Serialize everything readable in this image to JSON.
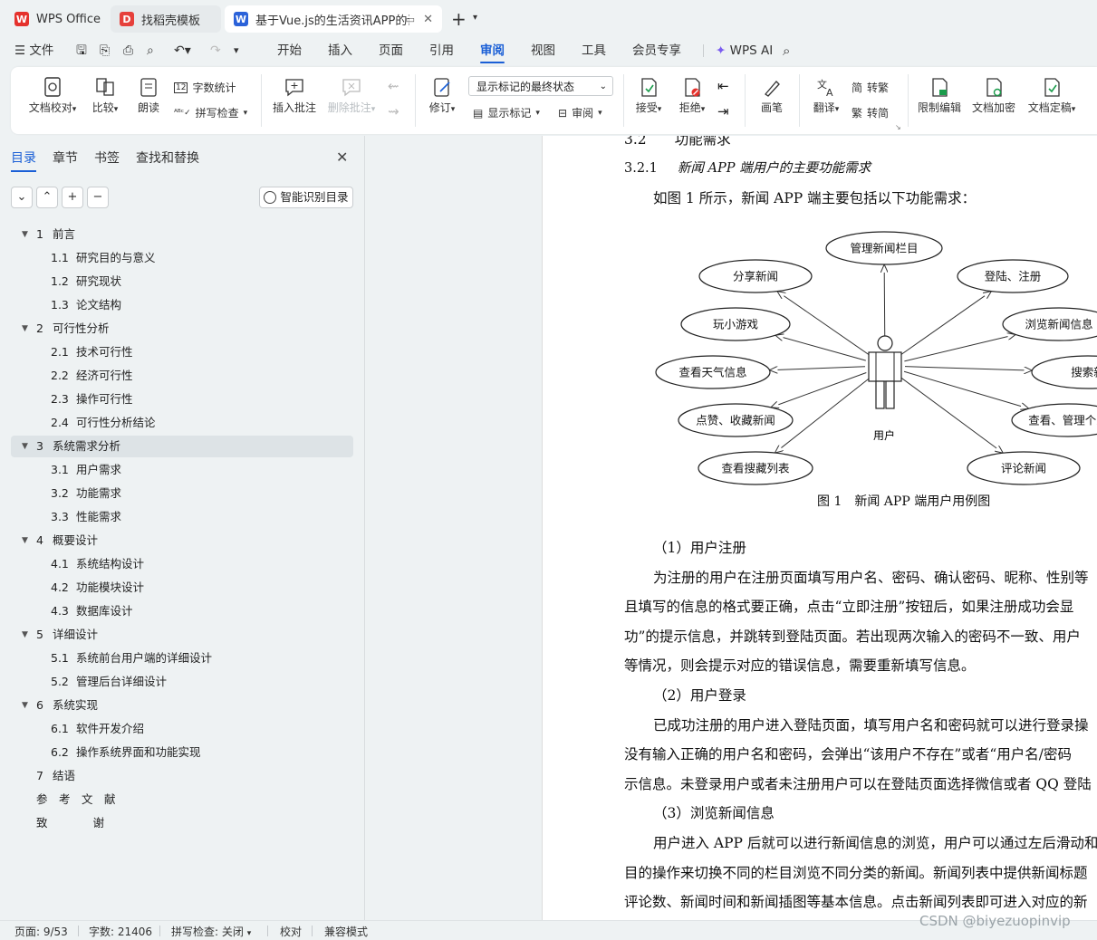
{
  "tabs": [
    {
      "label": "WPS Office",
      "icon": "wps-logo-icon"
    },
    {
      "label": "找稻壳模板",
      "icon": "docer-icon"
    },
    {
      "label": "基于Vue.js的生活资讯APP的设",
      "icon": "word-doc-icon"
    }
  ],
  "menu": {
    "file": "文件",
    "items": [
      "开始",
      "插入",
      "页面",
      "引用",
      "审阅",
      "视图",
      "工具",
      "会员专享"
    ],
    "active": "审阅",
    "wps_ai": "WPS AI"
  },
  "ribbon": {
    "proofread": "文档校对",
    "compare": "比较",
    "read_aloud": "朗读",
    "word_count": "字数统计",
    "spell_check": "拼写检查",
    "insert_comment": "插入批注",
    "delete_comment": "删除批注",
    "revise": "修订",
    "markup_state": "显示标记的最终状态",
    "show_markup": "显示标记",
    "review": "审阅",
    "accept": "接受",
    "reject": "拒绝",
    "pen": "画笔",
    "translate": "翻译",
    "to_traditional": "转繁",
    "to_simplified": "转简",
    "restrict_edit": "限制编辑",
    "encrypt": "文档加密",
    "finalize": "文档定稿"
  },
  "sidebar": {
    "tabs": [
      "目录",
      "章节",
      "书签",
      "查找和替换"
    ],
    "smart_toc": "智能识别目录",
    "toc": [
      {
        "num": "1",
        "title": "前言",
        "level": 1
      },
      {
        "num": "1.1",
        "title": "研究目的与意义",
        "level": 2
      },
      {
        "num": "1.2",
        "title": "研究现状",
        "level": 2
      },
      {
        "num": "1.3",
        "title": "论文结构",
        "level": 2
      },
      {
        "num": "2",
        "title": "可行性分析",
        "level": 1
      },
      {
        "num": "2.1",
        "title": "技术可行性",
        "level": 2
      },
      {
        "num": "2.2",
        "title": "经济可行性",
        "level": 2
      },
      {
        "num": "2.3",
        "title": "操作可行性",
        "level": 2
      },
      {
        "num": "2.4",
        "title": "可行性分析结论",
        "level": 2
      },
      {
        "num": "3",
        "title": "系统需求分析",
        "level": 1
      },
      {
        "num": "3.1",
        "title": "用户需求",
        "level": 2
      },
      {
        "num": "3.2",
        "title": "功能需求",
        "level": 2
      },
      {
        "num": "3.3",
        "title": "性能需求",
        "level": 2
      },
      {
        "num": "4",
        "title": "概要设计",
        "level": 1
      },
      {
        "num": "4.1",
        "title": "系统结构设计",
        "level": 2
      },
      {
        "num": "4.2",
        "title": "功能模块设计",
        "level": 2
      },
      {
        "num": "4.3",
        "title": "数据库设计",
        "level": 2
      },
      {
        "num": "5",
        "title": "详细设计",
        "level": 1
      },
      {
        "num": "5.1",
        "title": "系统前台用户端的详细设计",
        "level": 2
      },
      {
        "num": "5.2",
        "title": "管理后台详细设计",
        "level": 2
      },
      {
        "num": "6",
        "title": "系统实现",
        "level": 1
      },
      {
        "num": "6.1",
        "title": "软件开发介绍",
        "level": 2
      },
      {
        "num": "6.2",
        "title": "操作系统界面和功能实现",
        "level": 2
      },
      {
        "num": "7",
        "title": "结语",
        "level": 1
      },
      {
        "num": "",
        "title": "参　考　文　献",
        "level": 0
      },
      {
        "num": "",
        "title": "致　　　　谢",
        "level": 0
      }
    ]
  },
  "doc": {
    "heading_cut": "3.2　　功能需求",
    "sub_heading_num": "3.2.1",
    "sub_heading": "新闻 APP 端用户的主要功能需求",
    "intro": "如图 1 所示，新闻 APP 端主要包括以下功能需求：",
    "diagram": {
      "actor": "用户",
      "use_cases": [
        "管理新闻栏目",
        "分享新闻",
        "登陆、注册",
        "玩小游戏",
        "浏览新闻信息",
        "查看天气信息",
        "搜索新",
        "点赞、收藏新闻",
        "查看、管理个人",
        "查看搜藏列表",
        "评论新闻"
      ],
      "caption": "图 1　新闻 APP 端用户用例图"
    },
    "paragraphs": [
      "（1）用户注册",
      "为注册的用户在注册页面填写用户名、密码、确认密码、昵称、性别等",
      "且填写的信息的格式要正确，点击“立即注册”按钮后，如果注册成功会显",
      "功”的提示信息，并跳转到登陆页面。若出现两次输入的密码不一致、用户",
      "等情况，则会提示对应的错误信息，需要重新填写信息。",
      "（2）用户登录",
      "已成功注册的用户进入登陆页面，填写用户名和密码就可以进行登录操",
      "没有输入正确的用户名和密码，会弹出“该用户不存在”或者“用户名/密码",
      "示信息。未登录用户或者未注册用户可以在登陆页面选择微信或者 QQ 登陆",
      "（3）浏览新闻信息",
      "用户进入 APP 后就可以进行新闻信息的浏览，用户可以通过左后滑动和",
      "目的操作来切换不同的栏目浏览不同分类的新闻。新闻列表中提供新闻标题",
      "评论数、新闻时间和新闻插图等基本信息。点击新闻列表即可进入对应的新"
    ]
  },
  "status": {
    "page": "页面: 9/53",
    "words": "字数: 21406",
    "spell": "拼写检查: 关闭",
    "proof": "校对",
    "compat": "兼容模式",
    "watermark": "CSDN @biyezuopinvip"
  },
  "colors": {
    "accent": "#1a5fd6",
    "wps_red": "#e5322d",
    "docer_red": "#e6403b",
    "word_blue": "#2b62d9"
  }
}
